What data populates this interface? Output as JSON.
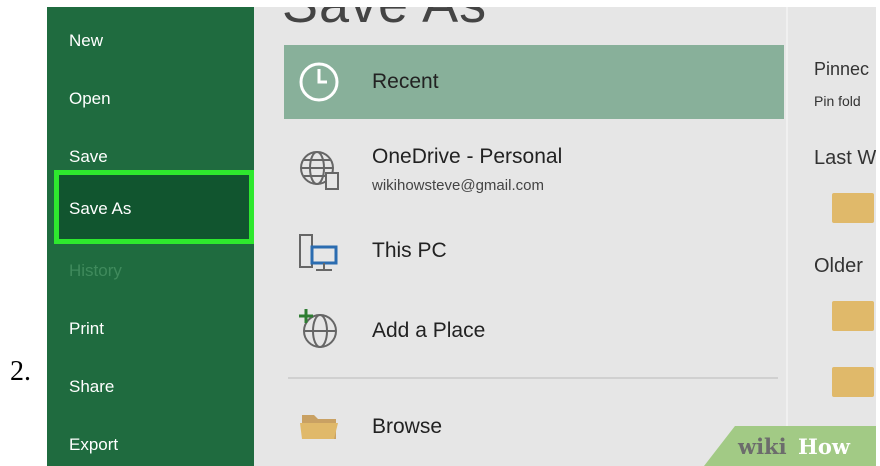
{
  "step_number": "2.",
  "sidebar": {
    "items": [
      {
        "label": "New"
      },
      {
        "label": "Open"
      },
      {
        "label": "Save"
      },
      {
        "label": "Save As"
      },
      {
        "label": "History"
      },
      {
        "label": "Print"
      },
      {
        "label": "Share"
      },
      {
        "label": "Export"
      }
    ]
  },
  "main": {
    "title": "Save As",
    "locations": [
      {
        "label": "Recent",
        "icon": "clock-icon"
      },
      {
        "label": "OneDrive - Personal",
        "sub": "wikihowsteve@gmail.com",
        "icon": "globe-icon"
      },
      {
        "label": "This PC",
        "icon": "computer-icon"
      },
      {
        "label": "Add a Place",
        "icon": "add-globe-icon"
      },
      {
        "label": "Browse",
        "icon": "folder-icon"
      }
    ]
  },
  "right_panel": {
    "pinned_label": "Pinnec",
    "pinned_sub": "Pin fold",
    "last_label": "Last W",
    "older_label": "Older"
  },
  "watermark": {
    "wiki": "wiki",
    "how": "How"
  },
  "colors": {
    "sidebar": "#1f6b3f",
    "selected": "#88b09a",
    "highlight": "#2ee82e"
  }
}
